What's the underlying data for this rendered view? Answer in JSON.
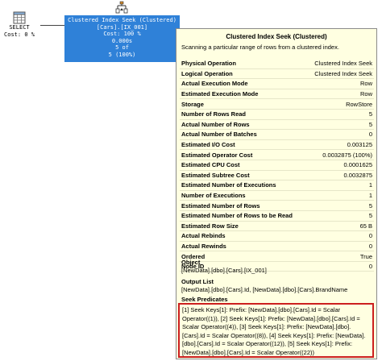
{
  "select_node": {
    "label": "SELECT",
    "cost": "Cost: 0 %"
  },
  "seek_node": {
    "lines": [
      "Clustered Index Seek (Clustered)",
      "[Cars].[IX_001]",
      "Cost: 100 %",
      "0.000s",
      "5 of",
      "5 (100%)"
    ]
  },
  "tooltip": {
    "title": "Clustered Index Seek (Clustered)",
    "description": "Scanning a particular range of rows from a clustered index.",
    "properties": [
      {
        "name": "Physical Operation",
        "value": "Clustered Index Seek"
      },
      {
        "name": "Logical Operation",
        "value": "Clustered Index Seek"
      },
      {
        "name": "Actual Execution Mode",
        "value": "Row"
      },
      {
        "name": "Estimated Execution Mode",
        "value": "Row"
      },
      {
        "name": "Storage",
        "value": "RowStore"
      },
      {
        "name": "Number of Rows Read",
        "value": "5"
      },
      {
        "name": "Actual Number of Rows",
        "value": "5"
      },
      {
        "name": "Actual Number of Batches",
        "value": "0"
      },
      {
        "name": "Estimated I/O Cost",
        "value": "0.003125"
      },
      {
        "name": "Estimated Operator Cost",
        "value": "0.0032875 (100%)"
      },
      {
        "name": "Estimated CPU Cost",
        "value": "0.0001625"
      },
      {
        "name": "Estimated Subtree Cost",
        "value": "0.0032875"
      },
      {
        "name": "Estimated Number of Executions",
        "value": "1"
      },
      {
        "name": "Number of Executions",
        "value": "1"
      },
      {
        "name": "Estimated Number of Rows",
        "value": "5"
      },
      {
        "name": "Estimated Number of Rows to be Read",
        "value": "5"
      },
      {
        "name": "Estimated Row Size",
        "value": "65 B"
      },
      {
        "name": "Actual Rebinds",
        "value": "0"
      },
      {
        "name": "Actual Rewinds",
        "value": "0"
      },
      {
        "name": "Ordered",
        "value": "True"
      },
      {
        "name": "Node ID",
        "value": "0"
      }
    ],
    "object_title": "Object",
    "object_value": "[NewData].[dbo].[Cars].[IX_001]",
    "output_title": "Output List",
    "output_value": "[NewData].[dbo].[Cars].Id, [NewData].[dbo].[Cars].BrandName",
    "seek_title": "Seek Predicates",
    "seek_value": "[1] Seek Keys[1]: Prefix: [NewData].[dbo].[Cars].Id = Scalar Operator((1)), [2] Seek Keys[1]: Prefix: [NewData].[dbo].[Cars].Id = Scalar Operator((4)), [3] Seek Keys[1]: Prefix: [NewData].[dbo].[Cars].Id = Scalar Operator((8)), [4] Seek Keys[1]: Prefix: [NewData].[dbo].[Cars].Id = Scalar Operator((12)), [5] Seek Keys[1]: Prefix: [NewData].[dbo].[Cars].Id = Scalar Operator((22))"
  },
  "colors": {
    "node_highlight": "#2f81d8",
    "tooltip_bg": "#ffffe1",
    "predicate_border": "#cc1f1f"
  },
  "icons": {
    "select": "select-table-icon",
    "seek": "clustered-index-seek-icon"
  }
}
